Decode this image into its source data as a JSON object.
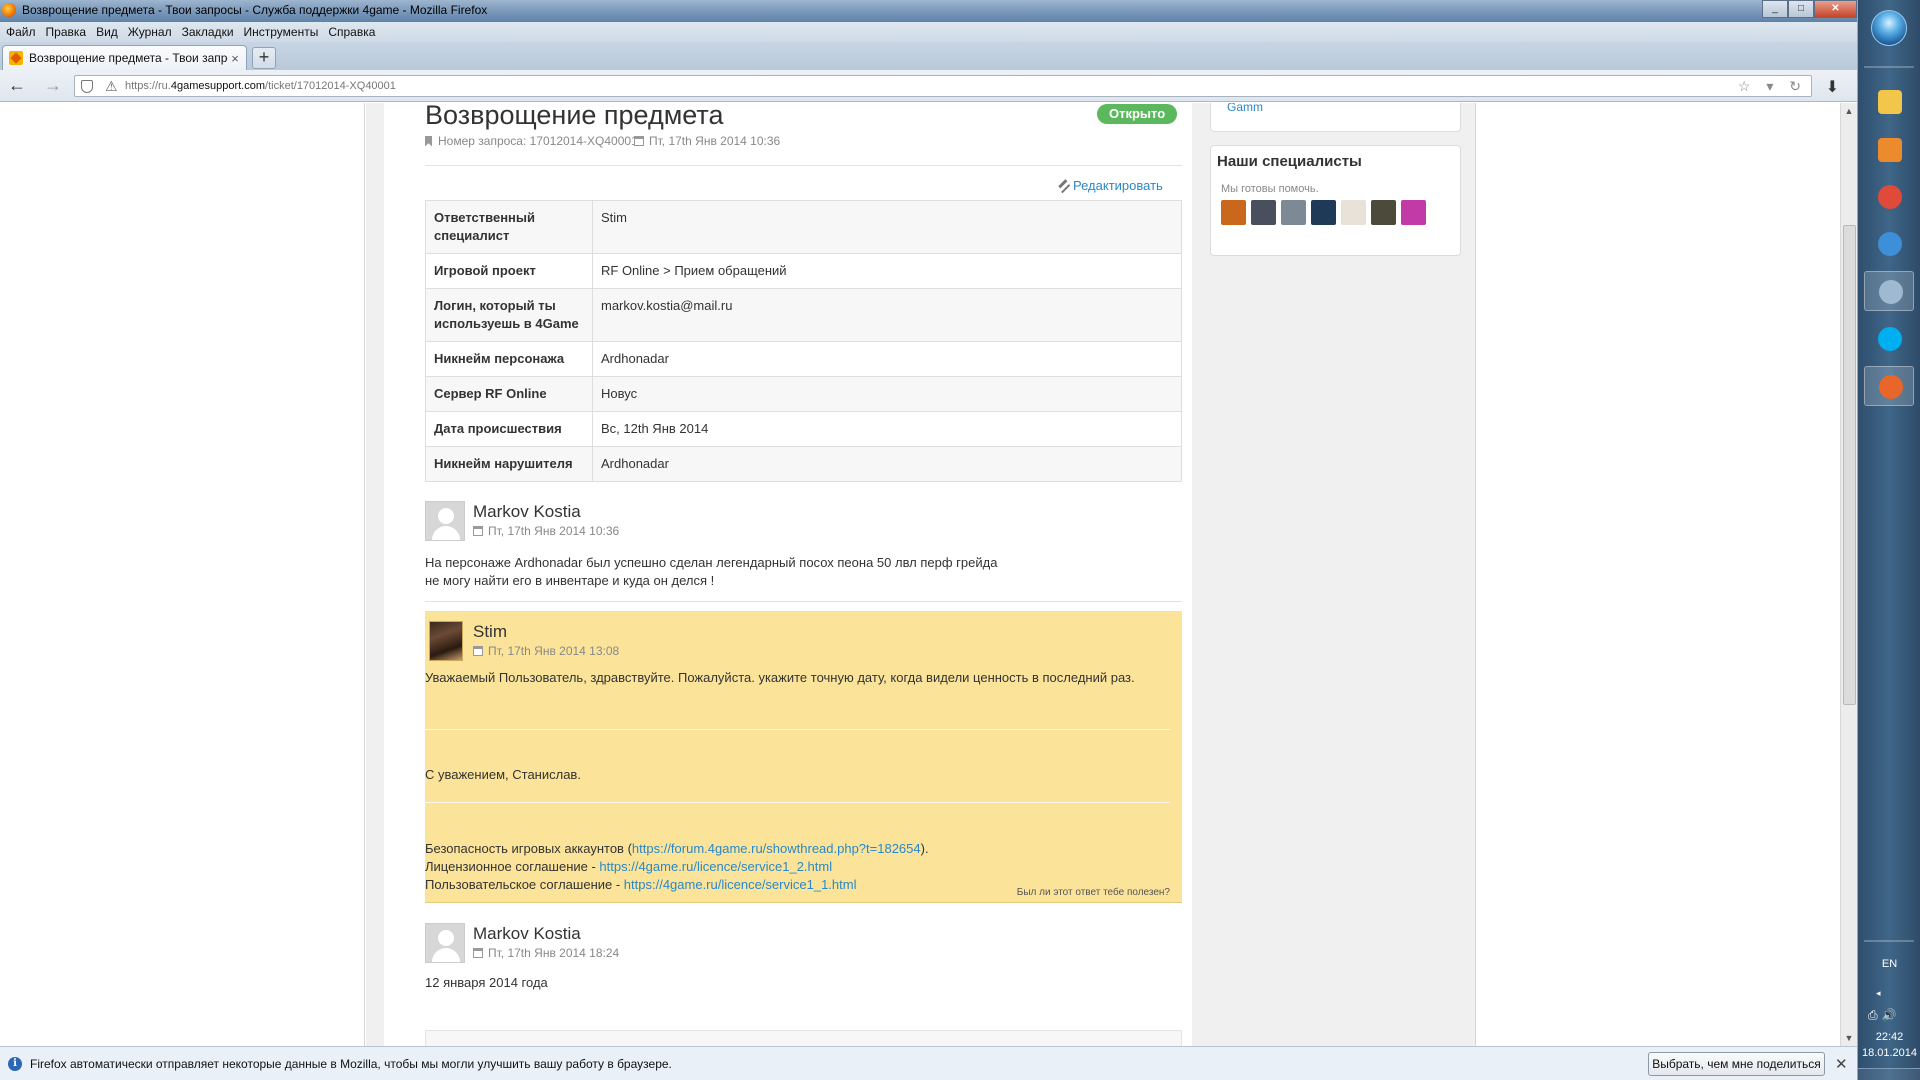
{
  "window": {
    "title": "Возврощение предмета - Твои запросы - Служба поддержки 4game - Mozilla Firefox",
    "controls": [
      "_",
      "□",
      "✕"
    ]
  },
  "menu": [
    "Файл",
    "Правка",
    "Вид",
    "Журнал",
    "Закладки",
    "Инструменты",
    "Справка"
  ],
  "tab": {
    "label": "Возврощение предмета - Твои запрос...",
    "close": "×",
    "new": "+"
  },
  "nav": {
    "back": "←",
    "forward": "→",
    "url_prefix": "https://ru.",
    "url_host": "4gamesupport.com",
    "url_path": "/ticket/17012014-XQ40001",
    "download": "⬇",
    "icons": "☆ ▾ ↻"
  },
  "ticket": {
    "title": "Возврощение предмета",
    "status": "Открыто",
    "number": "Номер запроса: 17012014-XQ40001",
    "date": "Пт, 17th Янв 2014 10:36",
    "edit": "Редактировать",
    "fields": [
      {
        "key": "Ответственный специалист",
        "value": "Stim"
      },
      {
        "key": "Игровой проект",
        "value": "RF Online > Прием обращений"
      },
      {
        "key": "Логин, который ты используешь в 4Game",
        "value": "markov.kostia@mail.ru"
      },
      {
        "key": "Никнейм персонажа",
        "value": "Ardhonadar"
      },
      {
        "key": "Сервер RF Online",
        "value": "Новус"
      },
      {
        "key": "Дата происшествия",
        "value": "Вс, 12th Янв 2014"
      },
      {
        "key": "Никнейм нарушителя",
        "value": "Ardhonadar"
      }
    ]
  },
  "messages": {
    "first": {
      "author": "Markov Kostia",
      "date": "Пт, 17th Янв 2014 10:36",
      "line1": "На персонаже Ardhonadar был успешно сделан легендарный посох пеона 50 лвл перф грейда",
      "line2": "не могу найти его в инвентаре и куда он делся !"
    },
    "staff": {
      "author": "Stim",
      "date": "Пт, 17th Янв 2014 13:08",
      "greeting": "Уважаемый Пользователь, здравствуйте. Пожалуйста. укажите точную дату, когда видели ценность в последний раз.",
      "signature": "С уважением, Станислав.",
      "security_label": "Безопасность игровых аккаунтов (",
      "security_link": "https://forum.4game.ru/showthread.php?t=182654",
      "security_tail": ").",
      "licence_label": "Лицензионное соглашение - ",
      "licence_link": "https://4game.ru/licence/service1_2.html",
      "user_label": "Пользовательское соглашение - ",
      "user_link": "https://4game.ru/licence/service1_1.html",
      "helpful": "Был ли этот ответ тебе полезен?"
    },
    "second": {
      "author": "Markov Kostia",
      "date": "Пт, 17th Янв 2014 18:24",
      "body": "12 января 2014 года"
    }
  },
  "sidebar": {
    "top_widget_text": "Gamm",
    "specialists_title": "Наши специалисты",
    "specialists_sub": "Мы готовы помочь.",
    "avatar_colors": [
      "#c9681d",
      "#4a4f5e",
      "#7d8a96",
      "#1f3a57",
      "#e8e2d8",
      "#4c4a3a",
      "#c23aa6"
    ]
  },
  "notification": {
    "text": "Firefox автоматически отправляет некоторые данные в Mozilla, чтобы мы могли улучшить вашу работу в браузере.",
    "button": "Выбрать, чем мне поделиться",
    "close": "✕",
    "icon": "i"
  },
  "taskbar": {
    "lang": "EN",
    "arrow": "◂",
    "tray_icons": "⎙🔊",
    "time": "22:42",
    "date": "18.01.2014",
    "apps": [
      {
        "name": "explorer",
        "color": "#f2c64b",
        "icon": "folder-icon"
      },
      {
        "name": "media",
        "color": "#ec8a2e",
        "icon": "media-player-icon"
      },
      {
        "name": "chrome",
        "color": "#e04a3a",
        "icon": "chrome-icon"
      },
      {
        "name": "downloader",
        "color": "#3d8fd8",
        "icon": "download-manager-icon"
      },
      {
        "name": "messenger",
        "color": "#9fb9d0",
        "icon": "messenger-icon"
      },
      {
        "name": "skype",
        "color": "#00aff0",
        "icon": "skype-icon"
      },
      {
        "name": "firefox",
        "color": "#e8662a",
        "icon": "firefox-icon"
      }
    ]
  }
}
